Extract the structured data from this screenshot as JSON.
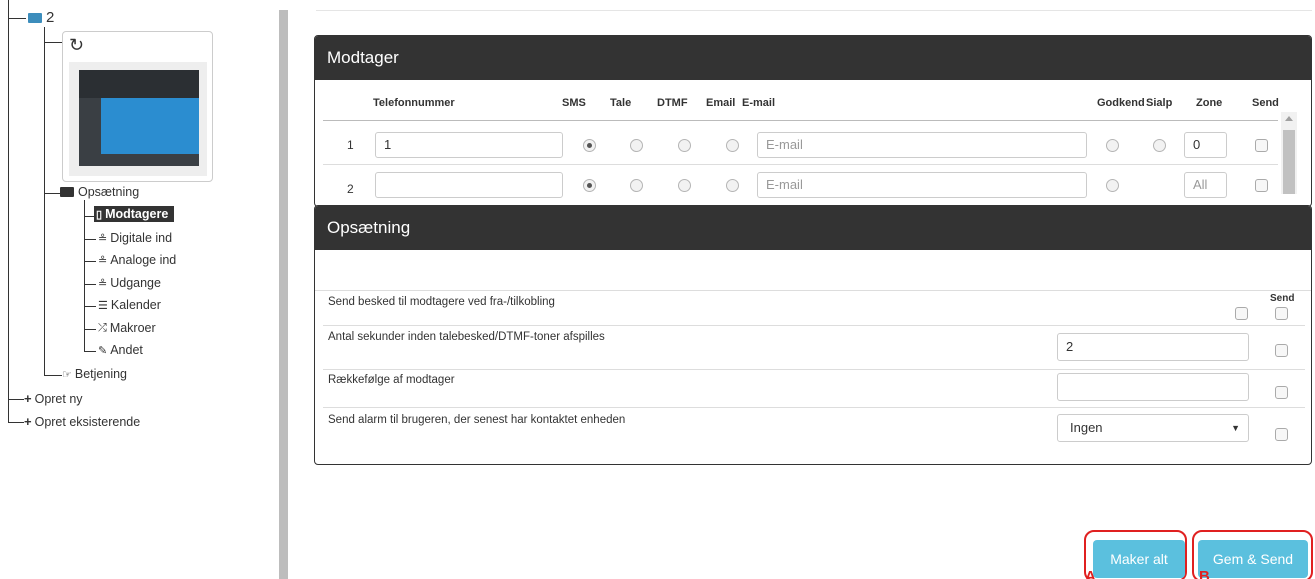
{
  "tree": {
    "root_label": "2",
    "setup_label": "Opsætning",
    "items": [
      {
        "label": "Modtagere",
        "icon": "phone-icon",
        "glyph": "▯"
      },
      {
        "label": "Digitale ind",
        "icon": "digital-input-icon",
        "glyph": "≗"
      },
      {
        "label": "Analoge ind",
        "icon": "analog-input-icon",
        "glyph": "≗"
      },
      {
        "label": "Udgange",
        "icon": "output-icon",
        "glyph": "≗"
      },
      {
        "label": "Kalender",
        "icon": "calendar-icon",
        "glyph": "☰"
      },
      {
        "label": "Makroer",
        "icon": "shuffle-icon",
        "glyph": "⤮"
      },
      {
        "label": "Andet",
        "icon": "edit-icon",
        "glyph": "✎"
      }
    ],
    "betjening_label": "Betjening",
    "opret_ny_label": "Opret ny",
    "opret_eks_label": "Opret eksisterende"
  },
  "receiver_panel": {
    "title": "Modtager",
    "headers": {
      "phone": "Telefonnummer",
      "sms": "SMS",
      "tale": "Tale",
      "dtmf": "DTMF",
      "email": "Email",
      "email_field": "E-mail",
      "godkend": "Godkend",
      "sialp": "Sialp",
      "zone": "Zone",
      "send": "Send"
    },
    "rows": [
      {
        "num": "1",
        "phone": "1",
        "email_placeholder": "E-mail",
        "zone": "0",
        "zone_placeholder": ""
      },
      {
        "num": "2",
        "phone": "",
        "email_placeholder": "E-mail",
        "zone": "",
        "zone_placeholder": "All"
      }
    ]
  },
  "setup_panel": {
    "title": "Opsætning",
    "send_header": "Send",
    "rows": [
      {
        "label": "Send besked til modtagere ved fra-/tilkobling"
      },
      {
        "label": "Antal sekunder inden talebesked/DTMF-toner afspilles",
        "value": "2"
      },
      {
        "label": "Rækkefølge af modtager",
        "value": ""
      },
      {
        "label": "Send alarm til brugeren, der senest har kontaktet enheden",
        "select_value": "Ingen"
      }
    ]
  },
  "buttons": {
    "maker_alt": "Maker alt",
    "gem_send": "Gem & Send"
  },
  "annotations": {
    "a": "A",
    "b": "B"
  },
  "colors": {
    "accent": "#5bc0de",
    "header": "#333333",
    "annotation": "#e02020",
    "folder": "#3c8dbc"
  }
}
